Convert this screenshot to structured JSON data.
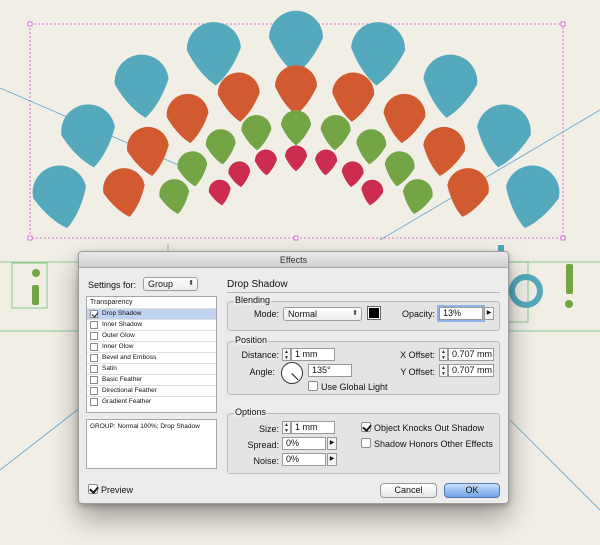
{
  "window": {
    "title": "Effects"
  },
  "settings_for": {
    "label": "Settings for:",
    "value": "Group"
  },
  "effects_list": {
    "title": "Transparency",
    "items": [
      {
        "label": "Drop Shadow",
        "checked": true,
        "selected": true
      },
      {
        "label": "Inner Shadow",
        "checked": false,
        "selected": false
      },
      {
        "label": "Outer Glow",
        "checked": false,
        "selected": false
      },
      {
        "label": "Inner Glow",
        "checked": false,
        "selected": false
      },
      {
        "label": "Bevel and Emboss",
        "checked": false,
        "selected": false
      },
      {
        "label": "Satin",
        "checked": false,
        "selected": false
      },
      {
        "label": "Basic Feather",
        "checked": false,
        "selected": false
      },
      {
        "label": "Directional Feather",
        "checked": false,
        "selected": false
      },
      {
        "label": "Gradient Feather",
        "checked": false,
        "selected": false
      }
    ]
  },
  "summary": "GROUP: Normal 100%; Drop Shadow",
  "preview": {
    "label": "Preview",
    "checked": true
  },
  "panel": {
    "title": "Drop Shadow",
    "blending": {
      "legend": "Blending",
      "mode_label": "Mode:",
      "mode_value": "Normal",
      "opacity_label": "Opacity:",
      "opacity_value": "13%",
      "color": "#000000"
    },
    "position": {
      "legend": "Position",
      "distance_label": "Distance:",
      "distance_value": "1 mm",
      "angle_label": "Angle:",
      "angle_value": "135°",
      "use_global_light": "Use Global Light",
      "x_offset_label": "X Offset:",
      "x_offset_value": "0.707 mm",
      "y_offset_label": "Y Offset:",
      "y_offset_value": "0.707 mm"
    },
    "options": {
      "legend": "Options",
      "size_label": "Size:",
      "size_value": "1 mm",
      "spread_label": "Spread:",
      "spread_value": "0%",
      "noise_label": "Noise:",
      "noise_value": "0%",
      "knocks_out_label": "Object Knocks Out Shadow",
      "honors_label": "Shadow Honors Other Effects"
    }
  },
  "buttons": {
    "cancel": "Cancel",
    "ok": "OK"
  },
  "colors": {
    "blue": "#54a9bd",
    "orange": "#d15a30",
    "green": "#73a544",
    "red": "#cc2c4d",
    "background": "#f1eee6",
    "selection": "#bfd2ef"
  }
}
